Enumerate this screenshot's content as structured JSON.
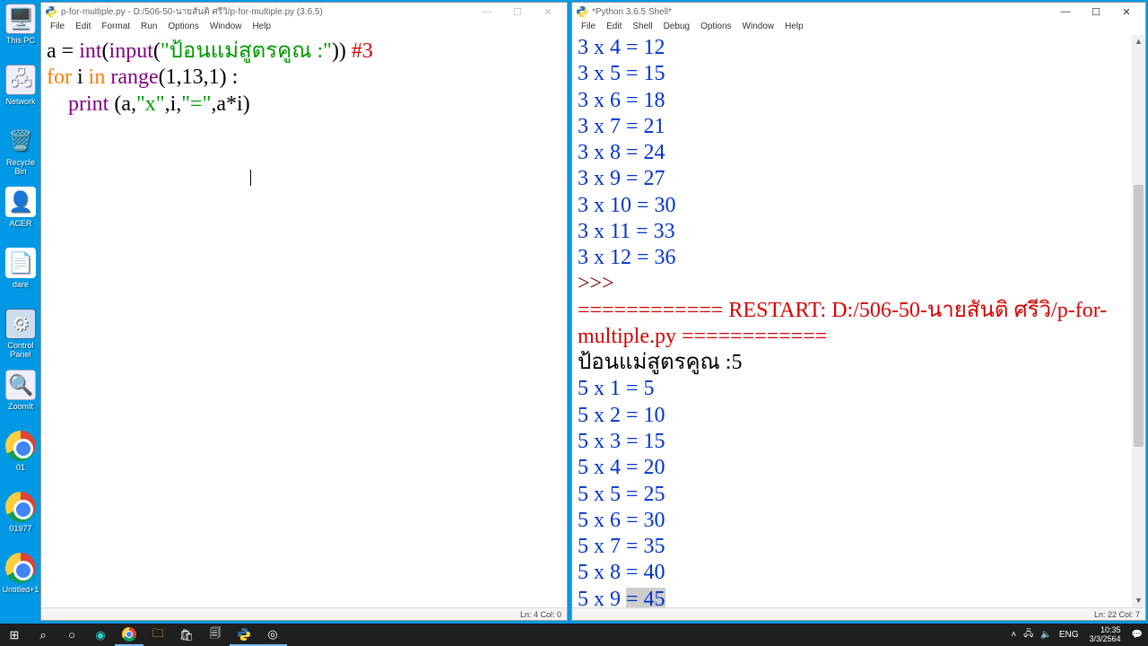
{
  "desktop_icons": [
    {
      "label": "This PC",
      "cls": "pc",
      "glyph": "🖥️"
    },
    {
      "label": "Network",
      "cls": "net",
      "glyph": "🖧"
    },
    {
      "label": "Recycle Bin",
      "cls": "bin",
      "glyph": "🗑️"
    },
    {
      "label": "ACER",
      "cls": "acer",
      "glyph": "👤"
    },
    {
      "label": "dare",
      "cls": "dare",
      "glyph": "📄"
    },
    {
      "label": "Control Panel",
      "cls": "cp",
      "glyph": "⚙"
    },
    {
      "label": "ZoomIt",
      "cls": "zoomit",
      "glyph": "🔍"
    },
    {
      "label": "01",
      "cls": "chrome",
      "glyph": ""
    },
    {
      "label": "01977",
      "cls": "chrome",
      "glyph": ""
    },
    {
      "label": "Untitled+1",
      "cls": "chrome",
      "glyph": ""
    }
  ],
  "editor": {
    "title": "p-for-multiple.py - D:/506-50-นายสันติ  ศรีวิ/p-for-multiple.py (3.6.5)",
    "menu": [
      "File",
      "Edit",
      "Format",
      "Run",
      "Options",
      "Window",
      "Help"
    ],
    "status": "Ln: 4  Col: 0",
    "code": {
      "line1": {
        "t1": "a = ",
        "fn1": "int",
        "t2": "(",
        "fn2": "input",
        "t3": "(",
        "str": "\"ป้อนแม่สูตรคูณ :\"",
        "t4": ")) ",
        "cm": "#3"
      },
      "line2": {
        "kw1": "for",
        "t1": " i ",
        "kw2": "in",
        "t2": " ",
        "fn": "range",
        "t3": "(1,13,1) :"
      },
      "line3": {
        "pad": "    ",
        "fn": "print",
        "t1": " (a,",
        "s1": "\"x\"",
        "t2": ",i,",
        "s2": "\"=\"",
        "t3": ",a*i)"
      }
    }
  },
  "shell": {
    "title": "*Python 3.6.5 Shell*",
    "menu": [
      "File",
      "Edit",
      "Shell",
      "Debug",
      "Options",
      "Window",
      "Help"
    ],
    "status": "Ln: 22  Col: 7",
    "top_output": [
      "3 x 4 = 12",
      "3 x 5 = 15",
      "3 x 6 = 18",
      "3 x 7 = 21",
      "3 x 8 = 24",
      "3 x 9 = 27",
      "3 x 10 = 30",
      "3 x 11 = 33",
      "3 x 12 = 36"
    ],
    "prompt": ">>> ",
    "restart": "============ RESTART: D:/506-50-นายสันติ  ศรีวิ/p-for-multiple.py ============",
    "input_label": "ป้อนแม่สูตรคูณ :",
    "input_val": "5",
    "bottom_output": [
      "5 x 1 = 5",
      "5 x 2 = 10",
      "5 x 3 = 15",
      "5 x 4 = 20",
      "5 x 5 = 25",
      "5 x 6 = 30",
      "5 x 7 = 35",
      "5 x 8 = 40"
    ],
    "last_prefix": "5 x 9 ",
    "last_hl": "= 45"
  },
  "tray": {
    "lang": "ENG",
    "time": "10:35",
    "date": "3/3/2564"
  }
}
